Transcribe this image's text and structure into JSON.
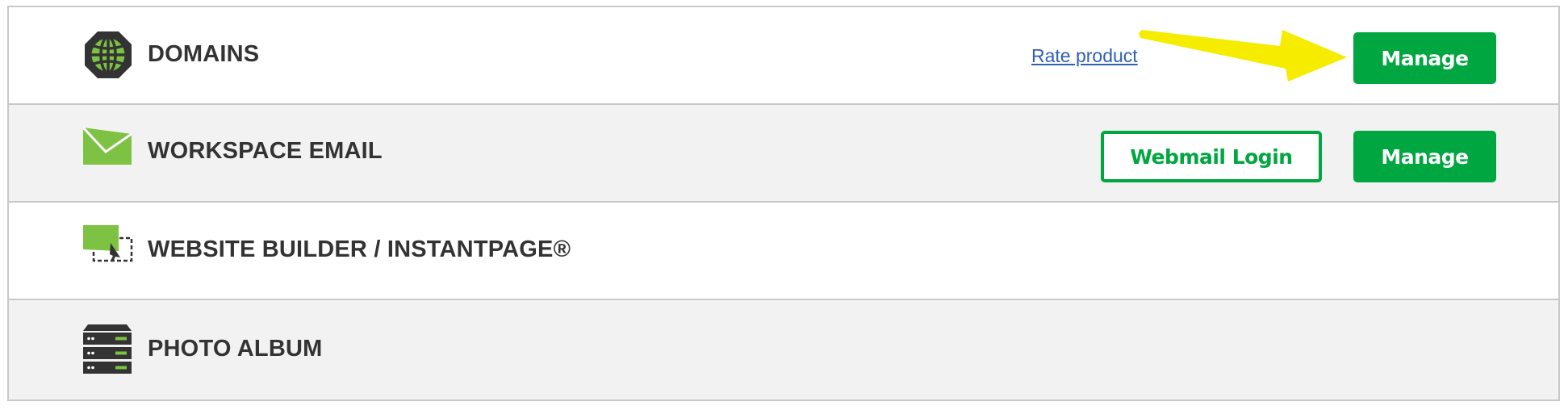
{
  "products": [
    {
      "title": "DOMAINS",
      "icon": "globe-icon",
      "rate_link": "Rate product",
      "manage_label": "Manage"
    },
    {
      "title": "WORKSPACE EMAIL",
      "icon": "envelope-icon",
      "webmail_label": "Webmail Login",
      "manage_label": "Manage"
    },
    {
      "title": "WEBSITE BUILDER / INSTANTPAGE®",
      "icon": "website-builder-icon"
    },
    {
      "title": "PHOTO ALBUM",
      "icon": "server-stack-icon"
    }
  ],
  "annotation": {
    "type": "arrow",
    "color": "#f5ec00",
    "points_to": "domains-manage-button"
  },
  "colors": {
    "brand_green": "#00a63f",
    "icon_green": "#7dc242",
    "icon_dark": "#333333",
    "link_blue": "#2f5fb3",
    "row_alt_bg": "#f2f2f2"
  }
}
